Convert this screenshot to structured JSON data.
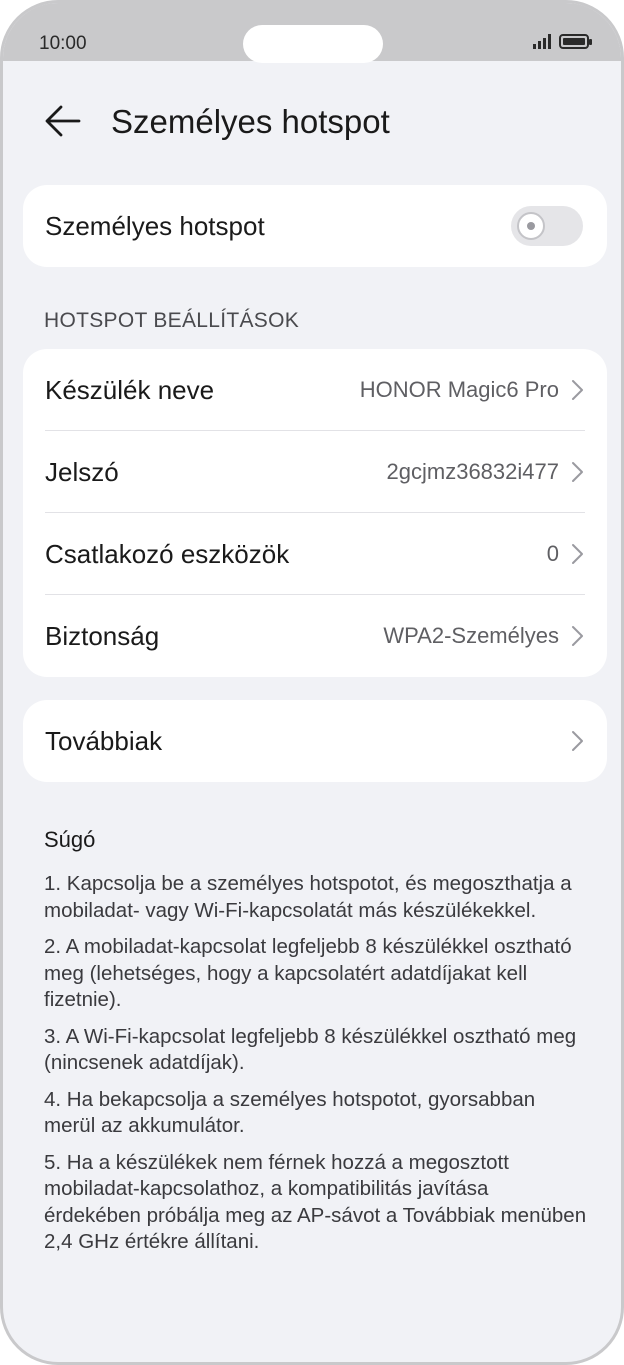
{
  "status_bar": {
    "time": "10:00"
  },
  "header": {
    "title": "Személyes hotspot"
  },
  "hotspot_toggle": {
    "label": "Személyes hotspot",
    "enabled": false
  },
  "settings": {
    "section_title": "HOTSPOT BEÁLLÍTÁSOK",
    "rows": [
      {
        "label": "Készülék neve",
        "value": "HONOR Magic6 Pro"
      },
      {
        "label": "Jelszó",
        "value": "2gcjmz36832i477"
      },
      {
        "label": "Csatlakozó eszközök",
        "value": "0"
      },
      {
        "label": "Biztonság",
        "value": "WPA2-Személyes"
      }
    ]
  },
  "more": {
    "label": "Továbbiak"
  },
  "help": {
    "title": "Súgó",
    "items": [
      "1. Kapcsolja be a személyes hotspotot, és megoszthatja a mobiladat- vagy Wi-Fi-kapcsolatát más készülékekkel.",
      "2. A mobiladat-kapcsolat legfeljebb 8 készülékkel osztható meg (lehetséges, hogy a kapcsolatért adatdíjakat kell fizetnie).",
      "3. A Wi-Fi-kapcsolat legfeljebb 8 készülékkel osztható meg (nincsenek adatdíjak).",
      "4. Ha bekapcsolja a személyes hotspotot, gyorsabban merül az akkumulátor.",
      "5. Ha a készülékek nem férnek hozzá a megosztott mobiladat-kapcsolathoz, a kompatibilitás javítása érdekében próbálja meg az AP-sávot a Továbbiak menüben 2,4 GHz értékre állítani."
    ]
  }
}
